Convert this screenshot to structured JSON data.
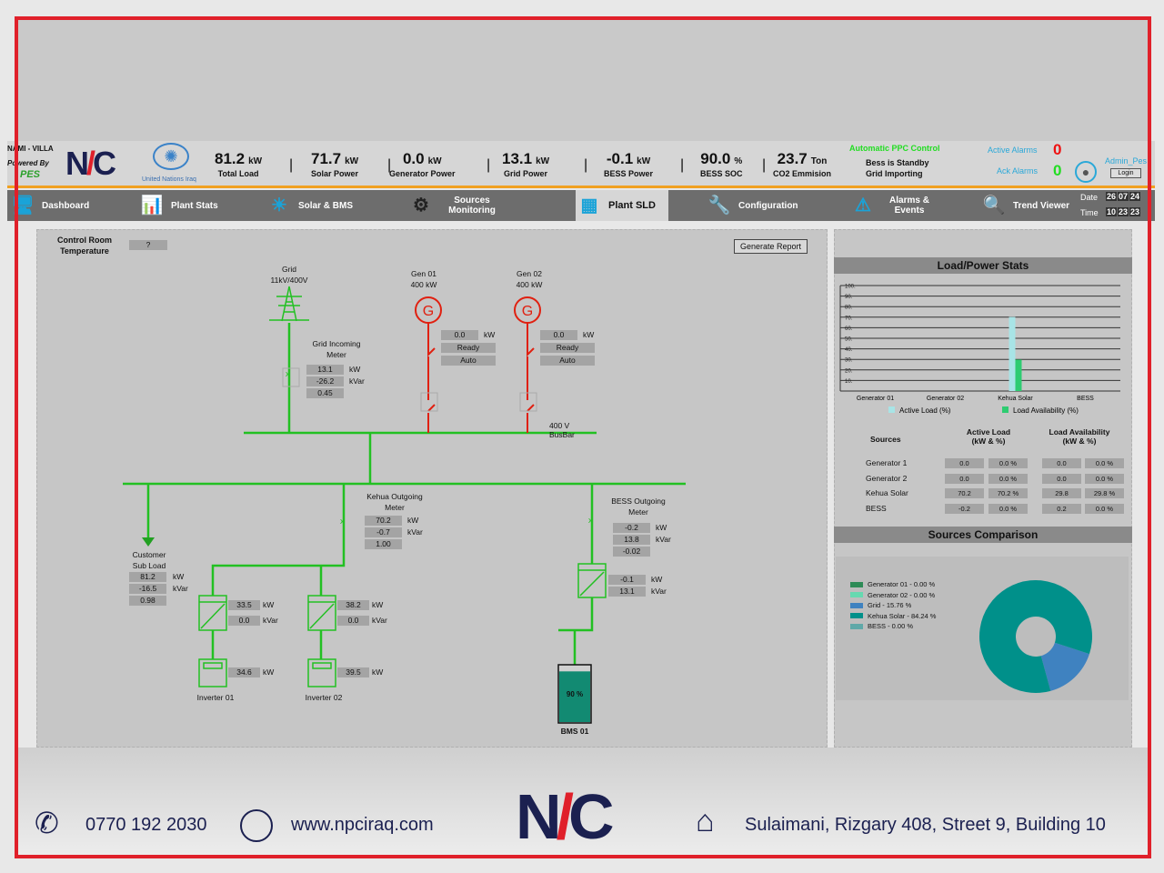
{
  "header": {
    "site": "NAMI - VILLA",
    "powered_by": "Powered By",
    "pes": "PES",
    "un_text": "United Nations Iraq",
    "kpis": [
      {
        "value": "81.2",
        "unit": "kW",
        "label": "Total Load"
      },
      {
        "value": "71.7",
        "unit": "kW",
        "label": "Solar Power"
      },
      {
        "value": "0.0",
        "unit": "kW",
        "label": "Generator Power"
      },
      {
        "value": "13.1",
        "unit": "kW",
        "label": "Grid Power"
      },
      {
        "value": "-0.1",
        "unit": "kW",
        "label": "BESS Power"
      },
      {
        "value": "90.0",
        "unit": "%",
        "label": "BESS SOC"
      },
      {
        "value": "23.7",
        "unit": "Ton",
        "label": "CO2 Emmision"
      }
    ],
    "ppc_title": "Automatic PPC Control",
    "ppc_status1": "Bess is Standby",
    "ppc_status2": "Grid Importing",
    "active_alarms_label": "Active Alarms",
    "active_alarms": "0",
    "ack_alarms_label": "Ack Alarms",
    "ack_alarms": "0",
    "user": "Admin_Pes",
    "login": "Login"
  },
  "nav": {
    "tabs": [
      "Dashboard",
      "Plant Stats",
      "Solar & BMS",
      "Sources Monitoring",
      "Plant SLD",
      "Configuration",
      "Alarms & Events",
      "Trend Viewer"
    ],
    "date_label": "Date",
    "date": [
      "26",
      "07",
      "24"
    ],
    "time_label": "Time",
    "time": [
      "10",
      "23",
      "23"
    ]
  },
  "sld": {
    "temp_label": "Control Room Temperature",
    "temp_value": "?",
    "report_button": "Generate Report",
    "grid_label": "Grid",
    "grid_rating": "11kV/400V",
    "grid_meter_label": "Grid Incoming Meter",
    "grid_meter": [
      "13.1",
      "-26.2",
      "0.45"
    ],
    "gen1": {
      "name": "Gen 01",
      "rating": "400 kW",
      "kw": "0.0",
      "state": "Ready",
      "mode": "Auto"
    },
    "gen2": {
      "name": "Gen 02",
      "rating": "400 kW",
      "kw": "0.0",
      "state": "Ready",
      "mode": "Auto"
    },
    "busbar_label": "400 V BusBar",
    "kehua_label": "Kehua Outgoing Meter",
    "kehua_meter": [
      "70.2",
      "-0.7",
      "1.00"
    ],
    "customer_label": "Customer Sub Load",
    "customer": [
      "81.2",
      "-16.5",
      "0.98"
    ],
    "inv1": {
      "ac_kw": "33.5",
      "ac_kvar": "0.0",
      "dc_kw": "34.6",
      "name": "Inverter 01"
    },
    "inv2": {
      "ac_kw": "38.2",
      "ac_kvar": "0.0",
      "dc_kw": "39.5",
      "name": "Inverter 02"
    },
    "bess_label": "BESS Outgoing Meter",
    "bess_meter": [
      "-0.2",
      "13.8",
      "-0.02"
    ],
    "bess_pcs": [
      "-0.1",
      "13.1"
    ],
    "bms_label": "BMS 01",
    "bms_soc_text": "90 %",
    "bms_soc": 90,
    "units": {
      "kw": "kW",
      "kvar": "kVar"
    }
  },
  "stats": {
    "title": "Load/Power Stats",
    "headers": [
      "Sources",
      "Active Load (kW & %)",
      "Load Availability (kW & %)"
    ],
    "rows": [
      [
        "Generator 1",
        "0.0",
        "0.0 %",
        "0.0",
        "0.0 %"
      ],
      [
        "Generator 2",
        "0.0",
        "0.0 %",
        "0.0",
        "0.0 %"
      ],
      [
        "Kehua Solar",
        "70.2",
        "70.2 %",
        "29.8",
        "29.8 %"
      ],
      [
        "BESS",
        "-0.2",
        "0.0 %",
        "0.2",
        "0.0 %"
      ]
    ]
  },
  "chart_data": [
    {
      "type": "bar",
      "categories": [
        "Generator 01",
        "Generator 02",
        "Kehua Solar",
        "BESS"
      ],
      "ylim": [
        0,
        100
      ],
      "yticks": [
        "10.",
        "20.",
        "30.",
        "40.",
        "50.",
        "60.",
        "70.",
        "80.",
        "90.",
        "100."
      ],
      "grid": true,
      "legend": "bottom",
      "series": [
        {
          "name": "Active Load (%)",
          "values": [
            0,
            0,
            70.2,
            0
          ],
          "color": "#a8e4e6"
        },
        {
          "name": "Load Availability (%)",
          "values": [
            0,
            0,
            29.8,
            0
          ],
          "color": "#2ecc71"
        }
      ]
    },
    {
      "type": "pie",
      "title": "Sources Comparison",
      "legend": "left",
      "donut": true,
      "slices": [
        {
          "label": "Generator 01 - 0.00 %",
          "value": 0,
          "color": "#2e8b57"
        },
        {
          "label": "Generator 02 - 0.00 %",
          "value": 0,
          "color": "#66d9b0"
        },
        {
          "label": "Grid - 15.76 %",
          "value": 15.76,
          "color": "#3f82c0"
        },
        {
          "label": "Kehua Solar - 84.24 %",
          "value": 84.24,
          "color": "#00908a"
        },
        {
          "label": "BESS - 0.00 %",
          "value": 0,
          "color": "#5fa8a8"
        }
      ]
    }
  ],
  "footer": {
    "phone": "0770 192 2030",
    "website": "www.npciraq.com",
    "address": "Sulaimani, Rizgary 408, Street 9, Building 10",
    "logo": "NPC"
  },
  "colors": {
    "frame": "#e0202a",
    "energized": "#22c022",
    "deenergized": "#e02010",
    "accent": "#f0a020"
  }
}
